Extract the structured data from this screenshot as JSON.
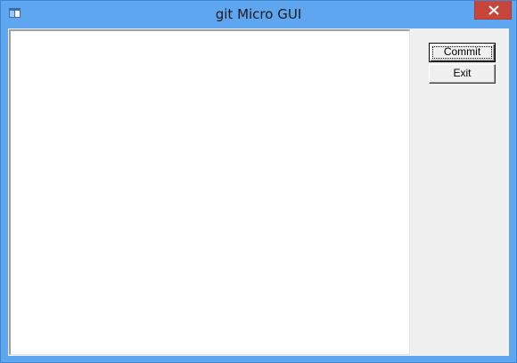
{
  "window": {
    "title": "git Micro GUI"
  },
  "icons": {
    "app": "app-window-icon",
    "close": "close-icon"
  },
  "editor": {
    "value": ""
  },
  "buttons": {
    "commit_label": "Commit",
    "exit_label": "Exit"
  },
  "colors": {
    "frame": "#5fa6f0",
    "close": "#c7463c",
    "client": "#f0f0f0",
    "editor": "#ffffff"
  }
}
